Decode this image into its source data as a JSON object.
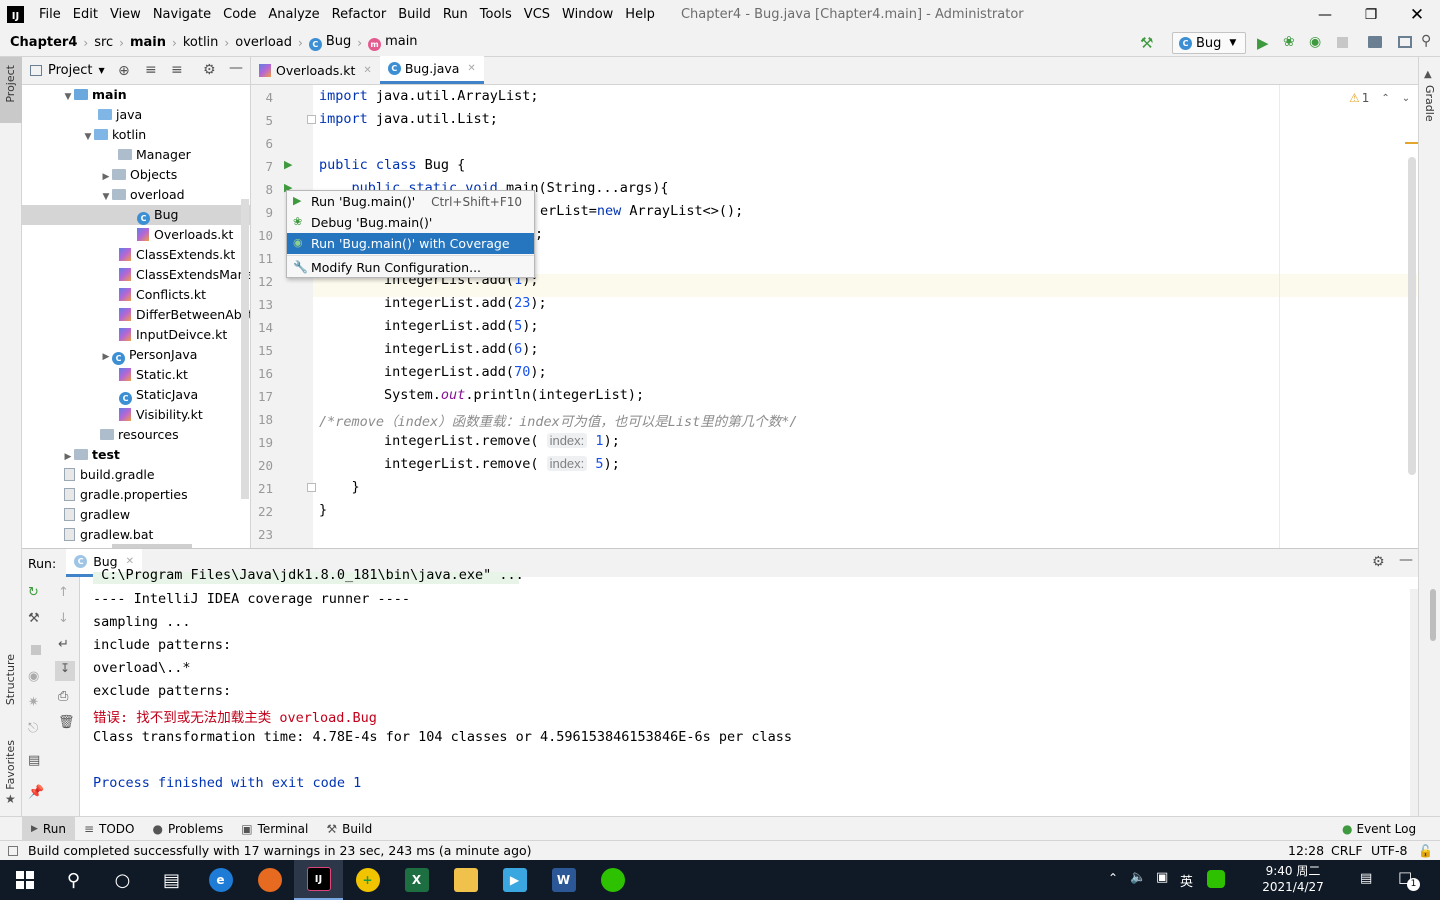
{
  "app": {
    "menu": [
      "File",
      "Edit",
      "View",
      "Navigate",
      "Code",
      "Analyze",
      "Refactor",
      "Build",
      "Run",
      "Tools",
      "VCS",
      "Window",
      "Help"
    ],
    "title": "Chapter4 - Bug.java [Chapter4.main] - Administrator"
  },
  "breadcrumb": [
    "Chapter4",
    "src",
    "main",
    "kotlin",
    "overload",
    "Bug",
    "main"
  ],
  "run_config": "Bug",
  "project_panel": {
    "header": "Project",
    "tree": [
      {
        "label": "main",
        "bold": true
      },
      {
        "label": "java"
      },
      {
        "label": "kotlin"
      },
      {
        "label": "Manager"
      },
      {
        "label": "Objects"
      },
      {
        "label": "overload"
      },
      {
        "label": "Bug"
      },
      {
        "label": "Overloads.kt"
      },
      {
        "label": "ClassExtends.kt"
      },
      {
        "label": "ClassExtendsManag"
      },
      {
        "label": "Conflicts.kt"
      },
      {
        "label": "DifferBetweenAbstr"
      },
      {
        "label": "InputDeivce.kt"
      },
      {
        "label": "PersonJava"
      },
      {
        "label": "Static.kt"
      },
      {
        "label": "StaticJava"
      },
      {
        "label": "Visibility.kt"
      },
      {
        "label": "resources"
      },
      {
        "label": "test",
        "bold": true
      },
      {
        "label": "build.gradle"
      },
      {
        "label": "gradle.properties"
      },
      {
        "label": "gradlew"
      },
      {
        "label": "gradlew.bat"
      }
    ]
  },
  "tabs": [
    {
      "label": "Overloads.kt"
    },
    {
      "label": "Bug.java"
    }
  ],
  "editor": {
    "line_numbers": [
      "4",
      "5",
      "6",
      "7",
      "8",
      "9",
      "10",
      "11",
      "12",
      "13",
      "14",
      "15",
      "16",
      "17",
      "18",
      "19",
      "20",
      "21",
      "22",
      "23"
    ],
    "warnings": "1",
    "code": {
      "l4": "java.util.ArrayList;",
      "l5": "java.util.List;",
      "l7_kw": "public class",
      "l7_rest": " Bug {",
      "l8_kw": "    public static void",
      "l8_rest": " main(String...args){",
      "l9a": "erList=",
      "l9kw": "new",
      "l9b": " ArrayList<>();",
      "l10": ";",
      "l12": "        integerList.add(",
      "l12n": "1",
      "l13n": "23",
      "l14n": "5",
      "l15n": "6",
      "l16n": "70",
      "add_prefix": "        integerList.add(",
      "add_suffix": ");",
      "l17a": "        System.",
      "l17f": "out",
      "l17b": ".println(integerList);",
      "l18": "/*remove（index）函数重载：index可为值，也可以是List里的第几个数*/",
      "remove_prefix": "        integerList.remove( ",
      "hint": "index:",
      "l19n": "1",
      "l20n": "5",
      "l21": "    }",
      "l22": "}",
      "import_kw": "import"
    }
  },
  "popup": {
    "items": [
      {
        "label": "Run 'Bug.main()'",
        "shortcut": "Ctrl+Shift+F10"
      },
      {
        "label": "Debug 'Bug.main()'",
        "shortcut": ""
      },
      {
        "label": "Run 'Bug.main()' with Coverage",
        "shortcut": ""
      },
      {
        "label": "Modify Run Configuration...",
        "shortcut": ""
      }
    ]
  },
  "run_panel": {
    "label": "Run:",
    "tab": "Bug",
    "output": [
      {
        "text": " C:\\Program Files\\Java\\jdk1.8.0_181\\bin\\java.exe\" ...",
        "color": "#000000"
      },
      {
        "text": "---- IntelliJ IDEA coverage runner ----",
        "color": "#000000"
      },
      {
        "text": "sampling ...",
        "color": "#000000"
      },
      {
        "text": "include patterns:",
        "color": "#000000"
      },
      {
        "text": "overload\\..*",
        "color": "#000000"
      },
      {
        "text": "exclude patterns:",
        "color": "#000000"
      },
      {
        "text": "错误: 找不到或无法加载主类 overload.Bug",
        "color": "#c2001a"
      },
      {
        "text": "Class transformation time: 4.78E-4s for 104 classes or 4.596153846153846E-6s per class",
        "color": "#000000"
      },
      {
        "text": "",
        "color": "#000000"
      },
      {
        "text": "Process finished with exit code 1",
        "color": "#0033b3"
      }
    ]
  },
  "bottom_tools": [
    "Run",
    "TODO",
    "Problems",
    "Terminal",
    "Build"
  ],
  "event_log": "Event Log",
  "status": {
    "message": "Build completed successfully with 17 warnings in 23 sec, 243 ms (a minute ago)",
    "position": "12:28",
    "line_sep": "CRLF",
    "encoding": "UTF-8"
  },
  "side_tabs": {
    "project": "Project",
    "structure": "Structure",
    "favorites": "Favorites",
    "gradle": "Gradle"
  },
  "taskbar": {
    "time": "9:40 周二",
    "date": "2021/4/27",
    "ime": "英",
    "notif_count": "1"
  }
}
